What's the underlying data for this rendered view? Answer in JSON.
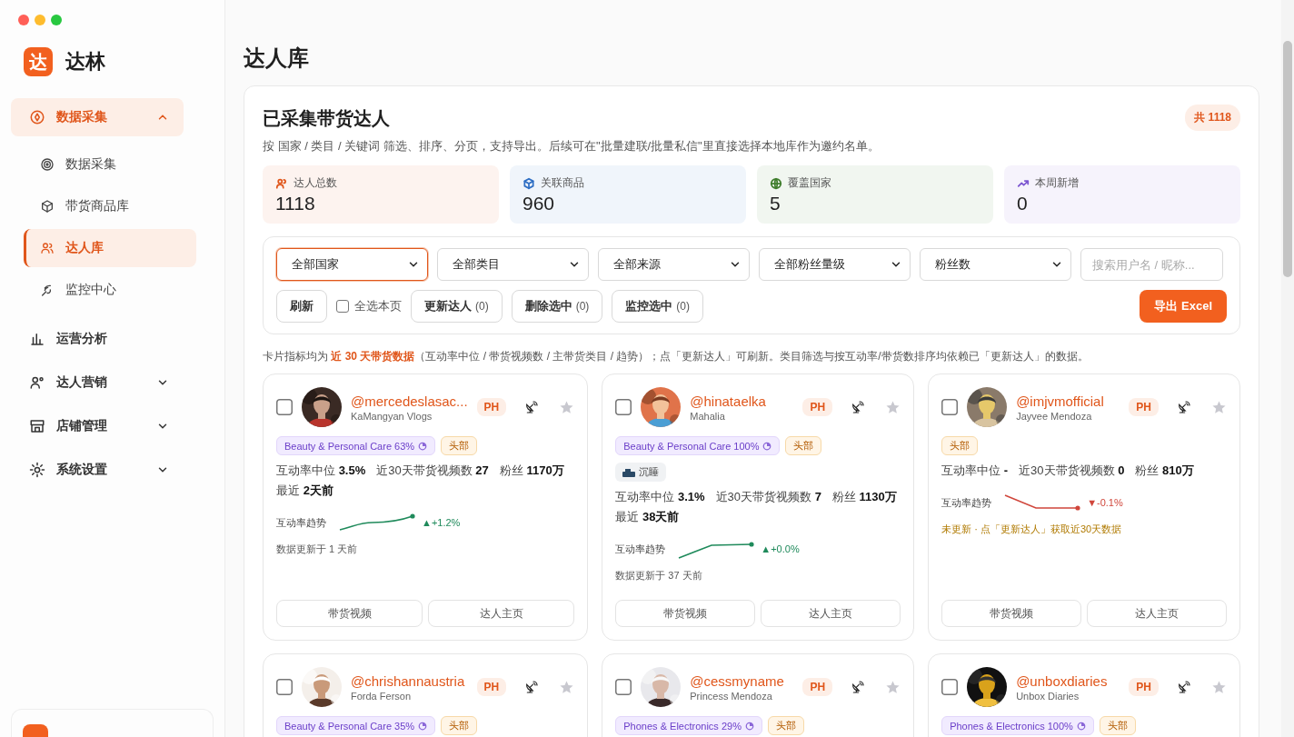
{
  "sidebar": {
    "brand": {
      "mark": "达",
      "name": "达林"
    },
    "nav": [
      {
        "label": "数据采集",
        "selected": true,
        "expanded": true,
        "children": [
          {
            "label": "数据采集",
            "selected": false
          },
          {
            "label": "带货商品库",
            "selected": false
          },
          {
            "label": "达人库",
            "selected": true
          },
          {
            "label": "监控中心",
            "selected": false
          }
        ]
      },
      {
        "label": "运营分析",
        "selected": false
      },
      {
        "label": "达人营销",
        "selected": false,
        "expanded": false
      },
      {
        "label": "店铺管理",
        "selected": false,
        "expanded": false
      },
      {
        "label": "系统设置",
        "selected": false,
        "expanded": false
      }
    ]
  },
  "page_title": "达人库",
  "panel": {
    "title": "已采集带货达人",
    "subtitle": "按 国家 / 类目 / 关键词 筛选、排序、分页，支持导出。后续可在\"批量建联/批量私信\"里直接选择本地库作为邀约名单。",
    "total_badge": "共 1118",
    "stats": [
      {
        "label": "达人总数",
        "value": "1118",
        "color": "#e0561b"
      },
      {
        "label": "关联商品",
        "value": "960",
        "color": "#2f6fc4"
      },
      {
        "label": "覆盖国家",
        "value": "5",
        "color": "#3f7d2c"
      },
      {
        "label": "本周新增",
        "value": "0",
        "color": "#7b55d0"
      }
    ],
    "filters": [
      {
        "value": "全部国家",
        "focused": true
      },
      {
        "value": "全部类目",
        "focused": false
      },
      {
        "value": "全部来源",
        "focused": false
      },
      {
        "value": "全部粉丝量级",
        "focused": false
      },
      {
        "value": "粉丝数",
        "focused": false
      }
    ],
    "search": {
      "placeholder": "搜索用户名 / 昵称..."
    },
    "refresh_button": "刷新",
    "select_all": {
      "label": "全选本页",
      "checked": false
    },
    "actions": [
      {
        "label": "更新达人",
        "count": "(0)"
      },
      {
        "label": "删除选中",
        "count": "(0)"
      },
      {
        "label": "监控选中",
        "count": "(0)"
      }
    ],
    "export_button": "导出 Excel",
    "note": "卡片指标均为 **近 30 天带货数据**（互动率中位 / 带货视频数 / 主带货类目 / 趋势）；点「更新达人」可刷新。类目筛选与按互动率/带货数排序均依赖已「更新达人」的数据。",
    "creators": [
      {
        "selected": false,
        "handle": "@mercedeslasac...",
        "name": "KaMangyan Vlogs",
        "country": "PH",
        "starred": false,
        "category": "Beauty & Personal Care 63%",
        "tier": "头部",
        "stat_lines": [
          [
            {
              "label": "互动率中位",
              "value": "3.5%"
            },
            {
              "label": "近30天带货视频数",
              "value": "27"
            },
            {
              "label": "粉丝",
              "value": "1170万"
            }
          ],
          [
            {
              "label": "最近",
              "value": "2天前"
            }
          ]
        ],
        "trend": {
          "label": "互动率趋势",
          "kind": "up",
          "change": "▲+1.2%"
        },
        "update_note": {
          "kind": "updated",
          "text": "数据更新于 1 天前"
        },
        "buttons": [
          "带货视频",
          "达人主页"
        ]
      },
      {
        "selected": false,
        "handle": "@hinataelka",
        "name": "Mahalia",
        "country": "PH",
        "starred": false,
        "category": "Beauty & Personal Care 100%",
        "tier": "头部",
        "status": "沉睡",
        "stat_lines": [
          [
            {
              "label": "互动率中位",
              "value": "3.1%"
            },
            {
              "label": "近30天带货视频数",
              "value": "7"
            },
            {
              "label": "粉丝",
              "value": "1130万"
            }
          ],
          [
            {
              "label": "最近",
              "value": "38天前"
            }
          ]
        ],
        "trend": {
          "label": "互动率趋势",
          "kind": "flat",
          "change": "▲+0.0%"
        },
        "update_note": {
          "kind": "updated",
          "text": "数据更新于 37 天前"
        },
        "buttons": [
          "带货视频",
          "达人主页"
        ]
      },
      {
        "selected": false,
        "handle": "@imjvmofficial",
        "name": "Jayvee Mendoza",
        "country": "PH",
        "starred": false,
        "tier": "头部",
        "stat_lines": [
          [
            {
              "label": "互动率中位",
              "value": "-"
            },
            {
              "label": "近30天带货视频数",
              "value": "0"
            },
            {
              "label": "粉丝",
              "value": "810万"
            }
          ]
        ],
        "trend": {
          "label": "互动率趋势",
          "kind": "down",
          "change": "▼-0.1%"
        },
        "update_note": {
          "kind": "stale",
          "text": "未更新 · 点「更新达人」获取近30天数据"
        },
        "buttons": [
          "带货视频",
          "达人主页"
        ]
      },
      {
        "selected": false,
        "handle": "@chrishannaustria",
        "name": "Forda Ferson",
        "country": "PH",
        "starred": false,
        "category": "Beauty & Personal Care 35%",
        "tier": "头部"
      },
      {
        "selected": false,
        "handle": "@cessmyname",
        "name": "Princess Mendoza",
        "country": "PH",
        "starred": false,
        "category": "Phones & Electronics 29%",
        "tier": "头部"
      },
      {
        "selected": false,
        "handle": "@unboxdiaries",
        "name": "Unbox Diaries",
        "country": "PH",
        "starred": false,
        "category": "Phones & Electronics 100%",
        "tier": "头部"
      }
    ]
  }
}
